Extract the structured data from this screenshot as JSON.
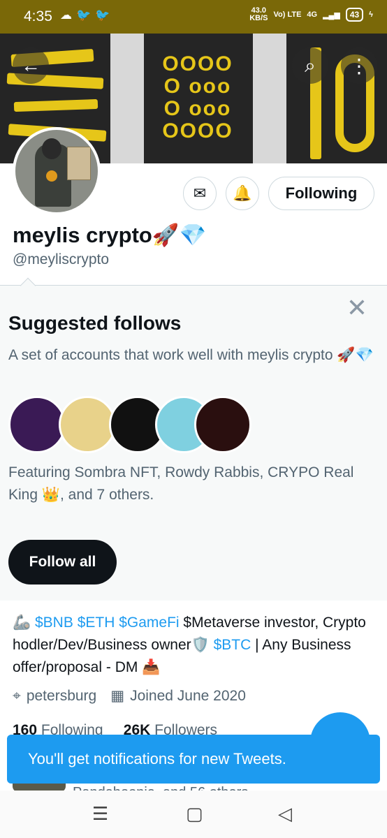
{
  "status_bar": {
    "time": "4:35",
    "left_icons": [
      "cloud-icon",
      "twitter-icon",
      "twitter-icon"
    ],
    "net_speed_value": "43.0",
    "net_speed_unit": "KB/S",
    "carrier": "Vo) LTE",
    "network": "4G",
    "battery": "43"
  },
  "header": {
    "back_icon": "back-arrow-icon",
    "search_icon": "search-icon",
    "more_icon": "more-vertical-icon"
  },
  "profile": {
    "display_name": "meylis crypto🚀💎",
    "handle": "@meyliscrypto",
    "following_label": "Following",
    "message_icon": "✉",
    "notify_icon": "🔔"
  },
  "suggested": {
    "title": "Suggested follows",
    "description": "A set of accounts that work well with meylis crypto 🚀💎",
    "avatar_colors": [
      "#3a1a55",
      "#e8d28a",
      "#111111",
      "#7fd0e0",
      "#2a0f0f"
    ],
    "featuring": "Featuring Sombra NFT, Rowdy Rabbis, CRYPO Real King 👑, and 7 others.",
    "follow_all_label": "Follow all",
    "close_label": "✕"
  },
  "bio": {
    "emoji1": "🦾",
    "tags1": "$BNB $ETH $GameFi",
    "text1": " $Metaverse investor, Crypto hodler/Dev/Business owner🛡️ ",
    "tag2": "$BTC",
    "text2": " | Any Business offer/proposal - DM 📥"
  },
  "meta": {
    "location": "petersburg",
    "joined": "Joined June 2020"
  },
  "counts": {
    "following_count": "160",
    "following_label": "Following",
    "followers_count": "26K",
    "followers_label": "Followers"
  },
  "toast": {
    "message": "You'll get notifications for new Tweets."
  },
  "followed_by": {
    "text": "Pandaboonie, and 56 others"
  },
  "fab": {
    "label": "+"
  },
  "nav": {
    "menu": "☰",
    "home": "▢",
    "back": "◁"
  }
}
